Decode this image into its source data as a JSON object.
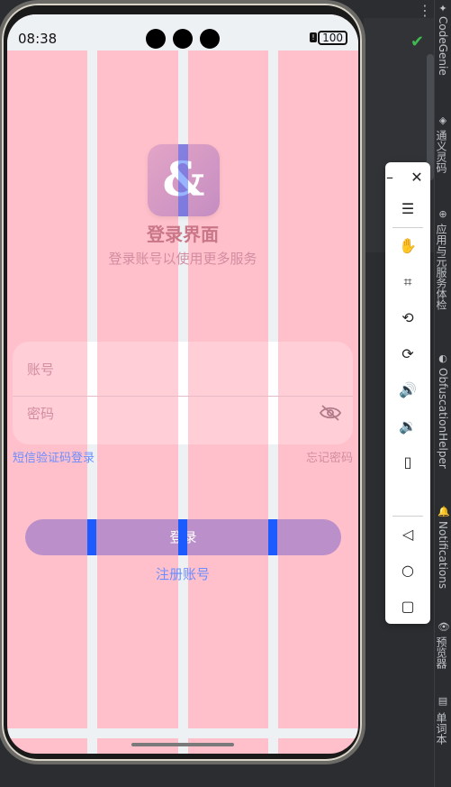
{
  "status_bar": {
    "time": "08:38",
    "battery": "100"
  },
  "app": {
    "title": "登录界面",
    "subtitle": "登录账号以使用更多服务",
    "account_placeholder": "账号",
    "password_placeholder": "密码",
    "sms_login": "短信验证码登录",
    "forgot_password": "忘记密码",
    "login_button": "登录",
    "register": "注册账号"
  },
  "ide": {
    "rail": [
      "CodeGenie",
      "通义灵码",
      "应用与元服务体检",
      "ObfuscationHelper",
      "Notifications",
      "预览器",
      "单词本"
    ]
  },
  "colors": {
    "accent_pink": "#ffc0cb",
    "grid_gray": "#eef1f4",
    "button_purple": "#bb8fca",
    "link_blue": "#6a8dff",
    "marker_blue": "#1c5cff"
  },
  "icons": {
    "logo": "app-logo-glyph",
    "password_toggle": "eye-off-icon",
    "close": "close-icon",
    "minimize": "minimize-icon",
    "menu": "menu-icon",
    "no_touch": "no-touch-icon",
    "crop": "crop-icon",
    "rotate_left": "rotate-icon",
    "rotate_right": "rotate-right-icon",
    "volume_up": "volume-up-icon",
    "volume_down": "volume-down-icon",
    "shake": "device-rotate-icon",
    "back": "back-triangle-icon",
    "home": "home-circle-icon",
    "recents": "recents-square-icon"
  }
}
